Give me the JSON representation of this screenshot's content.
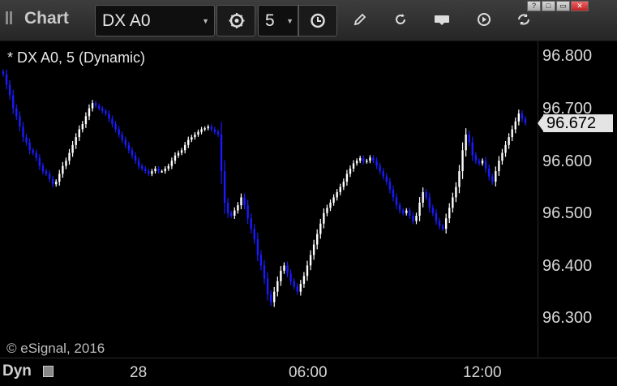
{
  "toolbar": {
    "title": "Chart",
    "symbol": "DX A0",
    "interval": "5",
    "icons": [
      "symbol-dropdown-icon",
      "settings-gear-icon",
      "interval-dropdown-icon",
      "clock-icon",
      "pencil-icon",
      "refresh-icon",
      "get-icon",
      "play-icon",
      "sync-icon"
    ],
    "window_buttons": [
      "?",
      "□",
      "▭",
      "✕"
    ]
  },
  "legend": "* DX A0, 5 (Dynamic)",
  "copyright": "© eSignal, 2016",
  "x_axis": {
    "mode_label": "Dyn",
    "ticks": [
      "28",
      "06:00",
      "12:00"
    ]
  },
  "last_price": "96.672",
  "colors": {
    "up": "#ffffff",
    "down": "#1a1aff",
    "background": "#000000",
    "text": "#d8d8d8"
  },
  "chart_data": {
    "type": "bar",
    "title": "* DX A0, 5 (Dynamic)",
    "ylim": [
      96.28,
      96.86
    ],
    "y_ticks": [
      "96.800",
      "96.700",
      "96.600",
      "96.500",
      "96.400",
      "96.300"
    ],
    "x_tick_labels": [
      "28",
      "06:00",
      "12:00"
    ],
    "last_value": 96.672,
    "series": [
      {
        "values": [
          96.765,
          96.745,
          96.725,
          96.7,
          96.685,
          96.665,
          96.645,
          96.635,
          96.62,
          96.615,
          96.605,
          96.59,
          96.58,
          96.575,
          96.565,
          96.555,
          96.56,
          96.575,
          96.59,
          96.6,
          96.615,
          96.63,
          96.645,
          96.66,
          96.67,
          96.685,
          96.7,
          96.71,
          96.705,
          96.7,
          96.695,
          96.69,
          96.68,
          96.67,
          96.66,
          96.65,
          96.64,
          96.63,
          96.62,
          96.61,
          96.6,
          96.59,
          96.585,
          96.58,
          96.575,
          96.58,
          96.585,
          96.58,
          96.58,
          96.585,
          96.59,
          96.6,
          96.61,
          96.615,
          96.62,
          96.63,
          96.64,
          96.645,
          96.65,
          96.655,
          96.66,
          96.662,
          96.665,
          96.66,
          96.655,
          96.65,
          96.58,
          96.52,
          96.5,
          96.495,
          96.505,
          96.515,
          96.53,
          96.515,
          96.49,
          96.47,
          96.45,
          96.42,
          96.4,
          96.375,
          96.345,
          96.33,
          96.35,
          96.37,
          96.39,
          96.4,
          96.385,
          96.37,
          96.36,
          96.35,
          96.365,
          96.38,
          96.4,
          96.42,
          96.44,
          96.46,
          96.48,
          96.5,
          96.51,
          96.52,
          96.53,
          96.54,
          96.55,
          96.56,
          96.575,
          96.585,
          96.595,
          96.6,
          96.605,
          96.598,
          96.6,
          96.606,
          96.6,
          96.59,
          96.58,
          96.57,
          96.56,
          96.545,
          96.53,
          96.515,
          96.505,
          96.5,
          96.505,
          96.495,
          96.485,
          96.495,
          96.52,
          96.54,
          96.53,
          96.51,
          96.5,
          96.485,
          96.475,
          96.47,
          96.49,
          96.51,
          96.53,
          96.55,
          96.58,
          96.62,
          96.65,
          96.635,
          96.61,
          96.6,
          96.595,
          96.6,
          96.585,
          96.57,
          96.56,
          96.58,
          96.6,
          96.615,
          96.63,
          96.645,
          96.66,
          96.675,
          96.69,
          96.68,
          96.672
        ]
      }
    ]
  }
}
